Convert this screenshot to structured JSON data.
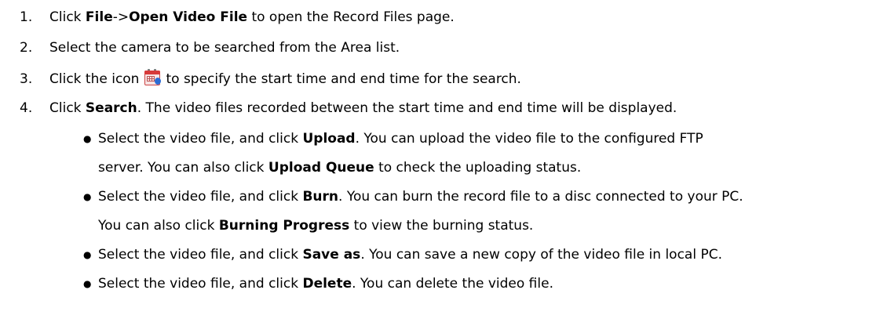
{
  "steps": [
    {
      "num": "1.",
      "parts": [
        "Click ",
        "File",
        "->",
        "Open Video File",
        " to open the Record Files page."
      ]
    },
    {
      "num": "2.",
      "text": "Select the camera to be searched from the Area list."
    },
    {
      "num": "3.",
      "before": "Click the icon",
      "after": "to specify the start time and end time for the search.",
      "icon": "calendar-icon"
    },
    {
      "num": "4.",
      "parts": [
        "Click ",
        "Search",
        ". The video files recorded between the start time and end time will be displayed."
      ]
    }
  ],
  "bullets": [
    {
      "symbol": "●",
      "l1": [
        "Select the video file, and click ",
        "Upload",
        ". You can upload the video file to the configured FTP"
      ],
      "l2": [
        "server. You can also click ",
        "Upload Queue",
        " to check the uploading status."
      ]
    },
    {
      "symbol": "●",
      "l1": [
        "Select the video file, and click ",
        "Burn",
        ". You can burn the record file to a disc connected to your PC."
      ],
      "l2": [
        "You can also click ",
        "Burning Progress",
        " to view the burning status."
      ]
    },
    {
      "symbol": "●",
      "l1": [
        "Select the video file, and click ",
        "Save as",
        ". You can save a new copy of the video file in local PC."
      ]
    },
    {
      "symbol": "●",
      "l1": [
        "Select the video file, and click ",
        "Delete",
        ". You can delete the video file."
      ]
    }
  ]
}
